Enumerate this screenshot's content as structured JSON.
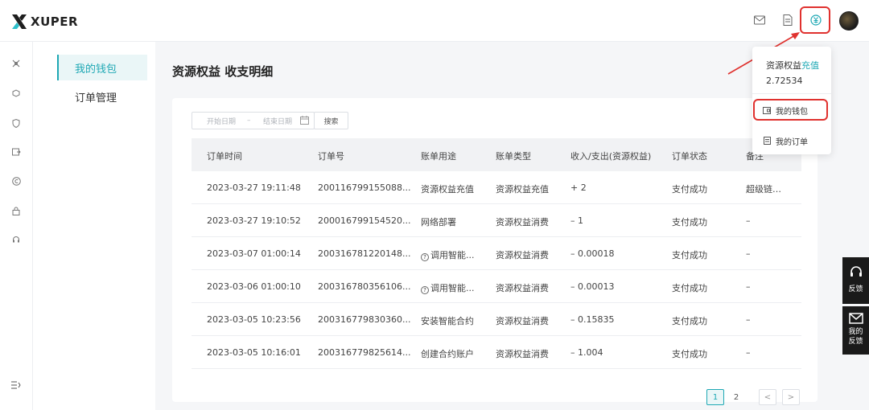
{
  "brand": {
    "name": "XUPER"
  },
  "colors": {
    "accent": "#1ea8b4",
    "highlight": "#e0312e",
    "logo_accent": "#2dbfca"
  },
  "topbar": {
    "icons": [
      "mail-icon",
      "document-icon",
      "currency-icon"
    ]
  },
  "leftnav": {
    "icons": [
      "grid-icon",
      "cube-icon",
      "shield-icon",
      "card-icon",
      "copyright-icon",
      "lock-icon",
      "headset-icon",
      "collapse-icon"
    ]
  },
  "submenu": {
    "items": [
      {
        "label": "我的钱包",
        "active": true
      },
      {
        "label": "订单管理",
        "active": false
      }
    ]
  },
  "page": {
    "title": "资源权益 收支明细"
  },
  "filter": {
    "start_placeholder": "开始日期",
    "separator": "–",
    "end_placeholder": "结束日期",
    "search_label": "搜索"
  },
  "table": {
    "columns": [
      "订单时间",
      "订单号",
      "账单用途",
      "账单类型",
      "收入/支出(资源权益)",
      "订单状态",
      "备注"
    ],
    "rows": [
      {
        "time": "2023-03-27 19:11:48",
        "order_no": "200116799155088...",
        "purpose": "资源权益充值",
        "help": false,
        "type": "资源权益充值",
        "amount": "+ 2",
        "status": "支付成功",
        "note": "超级链…"
      },
      {
        "time": "2023-03-27 19:10:52",
        "order_no": "200016799154520...",
        "purpose": "网络部署",
        "help": false,
        "type": "资源权益消费",
        "amount": "– 1",
        "status": "支付成功",
        "note": "–"
      },
      {
        "time": "2023-03-07 01:00:14",
        "order_no": "200316781220148...",
        "purpose": "调用智能...",
        "help": true,
        "type": "资源权益消费",
        "amount": "– 0.00018",
        "status": "支付成功",
        "note": "–"
      },
      {
        "time": "2023-03-06 01:00:10",
        "order_no": "200316780356106...",
        "purpose": "调用智能...",
        "help": true,
        "type": "资源权益消费",
        "amount": "– 0.00013",
        "status": "支付成功",
        "note": "–"
      },
      {
        "time": "2023-03-05 10:23:56",
        "order_no": "200316779830360...",
        "purpose": "安装智能合约",
        "help": false,
        "type": "资源权益消费",
        "amount": "– 0.15835",
        "status": "支付成功",
        "note": "–"
      },
      {
        "time": "2023-03-05 10:16:01",
        "order_no": "200316779825614...",
        "purpose": "创建合约账户",
        "help": false,
        "type": "资源权益消费",
        "amount": "– 1.004",
        "status": "支付成功",
        "note": "–"
      }
    ]
  },
  "pagination": {
    "pages": [
      "1",
      "2"
    ],
    "current": "1",
    "prev": "<",
    "next": ">"
  },
  "dropdown": {
    "title": "资源权益",
    "recharge_link": "充值",
    "balance": "2.72534",
    "items": [
      {
        "label": "我的钱包",
        "icon": "wallet-icon"
      },
      {
        "label": "我的订单",
        "icon": "order-icon"
      }
    ]
  },
  "side_buttons": {
    "feedback": "反馈",
    "my_feedback_line1": "我的",
    "my_feedback_line2": "反馈"
  }
}
